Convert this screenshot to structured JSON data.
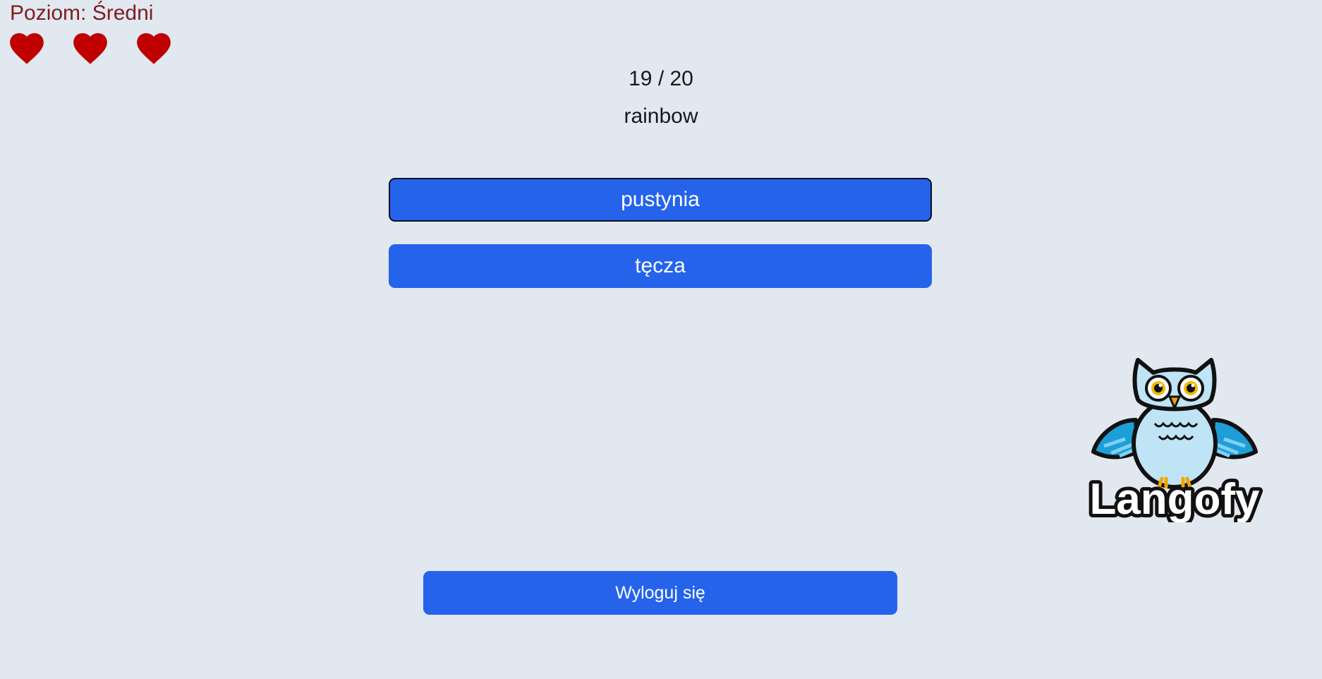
{
  "header": {
    "level_label": "Poziom: Średni",
    "lives": 3
  },
  "quiz": {
    "progress": "19 / 20",
    "word": "rainbow",
    "answers": [
      {
        "label": "pustynia",
        "selected": true
      },
      {
        "label": "tęcza",
        "selected": false
      }
    ]
  },
  "footer": {
    "logout_label": "Wyloguj się"
  },
  "brand": {
    "logo_text": "Langofy",
    "logo_icon": "owl-icon"
  },
  "colors": {
    "background": "#e2e8f0",
    "accent": "#2563eb",
    "heart": "#c00000",
    "level_text": "#7f1d1d"
  },
  "icons": {
    "heart": "heart-icon"
  }
}
